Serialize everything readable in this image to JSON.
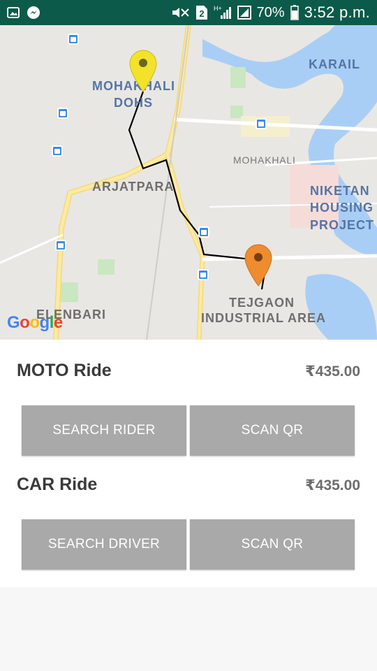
{
  "status_bar": {
    "battery_percent": "70%",
    "time": "3:52 p.m.",
    "sim_badge": "2",
    "network_type": "H+",
    "icons": [
      "gallery-icon",
      "messenger-icon",
      "mute-icon",
      "sim-2-icon",
      "signal-icon",
      "signal-2-icon",
      "battery-icon"
    ],
    "background_color": "#0c5a4a"
  },
  "map": {
    "labels": {
      "karail": "KARAIL",
      "mohakhali_dohs_1": "MOHAKHALI",
      "mohakhali_dohs_2": "DOHS",
      "mohakhali": "MOHAKHALI",
      "arjatpara": "ARJATPARA",
      "niketan_1": "NIKETAN",
      "niketan_2": "HOUSING",
      "niketan_3": "PROJECT",
      "tejgaon_1": "TEJGAON",
      "tejgaon_2": "INDUSTRIAL AREA",
      "elenbari": "ELENBARI"
    },
    "start_pin_color": "#f2e22a",
    "end_pin_color": "#ee8c2f",
    "attribution": "Google"
  },
  "rides": [
    {
      "title": "MOTO Ride",
      "price": "₹435.00",
      "buttons": [
        "SEARCH RIDER",
        "SCAN QR"
      ]
    },
    {
      "title": "CAR Ride",
      "price": "₹435.00",
      "buttons": [
        "SEARCH DRIVER",
        "SCAN QR"
      ]
    }
  ],
  "colors": {
    "button_bg": "#a9a9a9",
    "button_text": "#ffffff"
  }
}
